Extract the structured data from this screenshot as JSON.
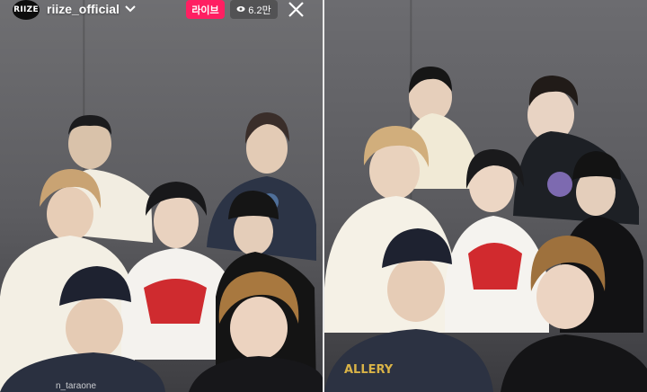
{
  "header": {
    "avatar_text": "RIIZE",
    "username": "riize_official",
    "live_label": "라이브",
    "viewer_count": "6.2만",
    "icons": {
      "dropdown": "chevron-down-icon",
      "viewers": "eye-icon",
      "close": "close-icon"
    }
  },
  "overlay": {
    "comment_username": "n_taraone"
  },
  "colors": {
    "live_badge": "#ff1f62",
    "wall": "#5e5e62"
  }
}
